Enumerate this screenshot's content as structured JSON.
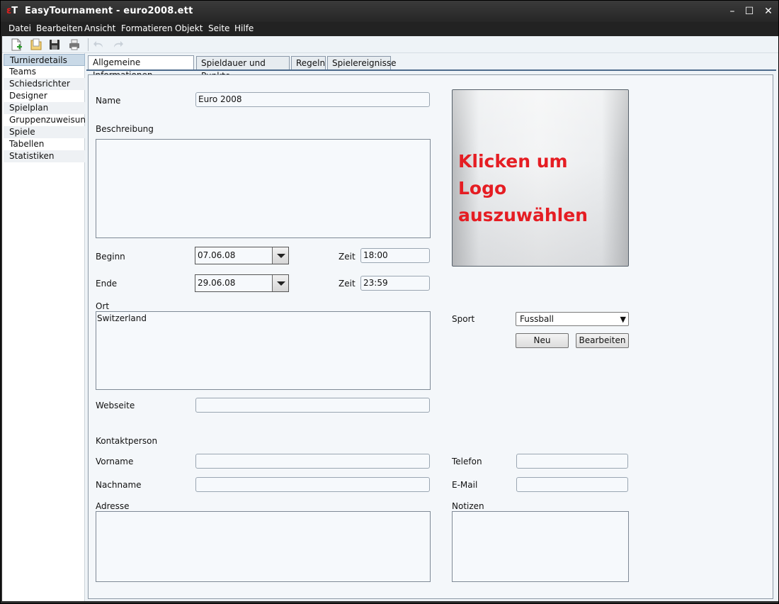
{
  "window": {
    "title": "EasyTournament - euro2008.ett",
    "icon_letters": "T",
    "minimize": "–",
    "maximize": "☐",
    "close": "✕"
  },
  "menu": [
    "Datei",
    "Bearbeiten",
    "Ansicht",
    "Formatieren",
    "Objekt",
    "Seite",
    "Hilfe"
  ],
  "toolbar": {
    "icons": [
      "new-document-icon",
      "open-icon",
      "save-icon",
      "print-icon",
      "undo-icon",
      "redo-icon"
    ]
  },
  "sidebar": {
    "items": [
      "Turnierdetails",
      "Teams",
      "Schiedsrichter",
      "Designer",
      "Spielplan",
      "Gruppenzuweisung",
      "Spiele",
      "Tabellen",
      "Statistiken"
    ],
    "selected": "Turnierdetails"
  },
  "tabs": [
    "Allgemeine Informationen",
    "Spieldauer und Punkte",
    "Regeln",
    "Spielereignisse"
  ],
  "form": {
    "name_label": "Name",
    "name_value": "Euro 2008",
    "description_label": "Beschreibung",
    "description_value": "",
    "begin_label": "Beginn",
    "begin_date": "07.06.08",
    "begin_time_label": "Zeit",
    "begin_time": "18:00",
    "end_label": "Ende",
    "end_date": "29.06.08",
    "end_time_label": "Zeit",
    "end_time": "23:59",
    "location_label": "Ort",
    "location_value": "Switzerland",
    "website_label": "Webseite",
    "website_value": "",
    "contact_heading": "Kontaktperson",
    "firstname_label": "Vorname",
    "firstname_value": "",
    "lastname_label": "Nachname",
    "lastname_value": "",
    "address_label": "Adresse",
    "address_value": "",
    "phone_label": "Telefon",
    "phone_value": "",
    "email_label": "E-Mail",
    "email_value": "",
    "notes_label": "Notizen",
    "notes_value": "",
    "logo_text_line1": "Klicken um",
    "logo_text_line2": "Logo auszuwählen",
    "sport_label": "Sport",
    "sport_value": "Fussball",
    "new_button": "Neu",
    "edit_button": "Bearbeiten"
  },
  "colors": {
    "logo_text": "#e51d23",
    "selection": "#c9d9e7",
    "panel_bg": "#f4f7fa"
  }
}
